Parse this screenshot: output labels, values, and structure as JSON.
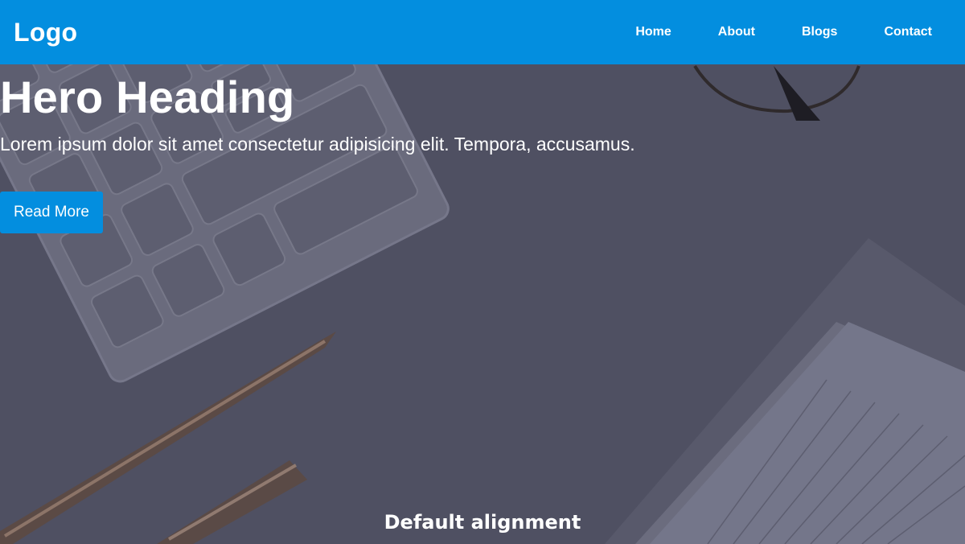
{
  "navbar": {
    "logo": "Logo",
    "links": [
      "Home",
      "About",
      "Blogs",
      "Contact"
    ],
    "background": "#038edf"
  },
  "hero": {
    "heading": "Hero Heading",
    "text": "Lorem ipsum dolor sit amet consectetur adipisicing elit. Tempora, accusamus.",
    "button_label": "Read More",
    "button_color": "#038edf",
    "overlay_color": "#4f5062"
  },
  "caption": "Default alignment"
}
